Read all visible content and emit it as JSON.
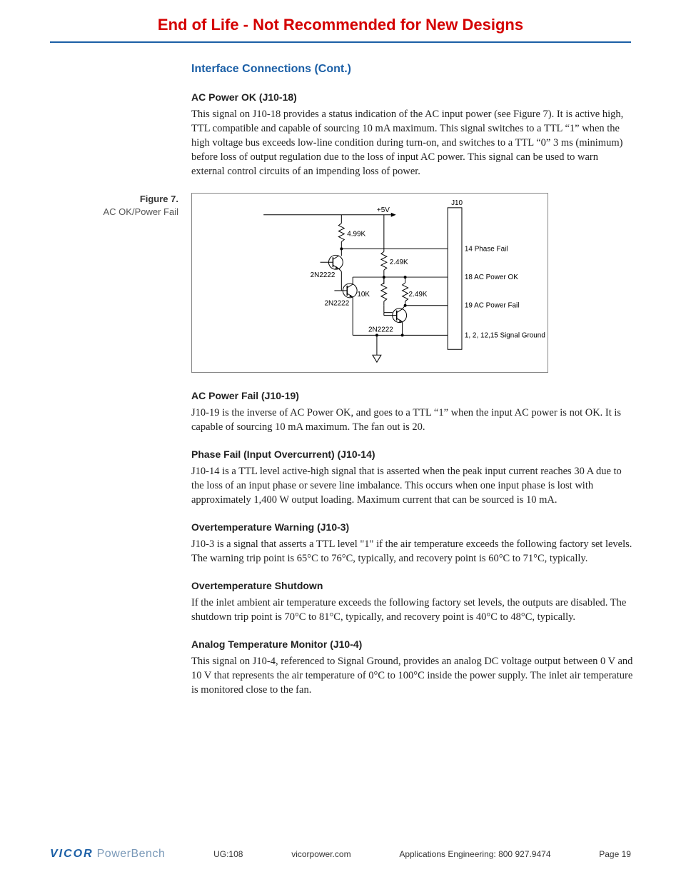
{
  "banner": "End of Life - Not Recommended for New Designs",
  "sectionTitle": "Interface Connections (Cont.)",
  "sections": [
    {
      "heading": "AC Power OK (J10-18)",
      "body": "This signal on J10-18 provides a status indication of the AC input power (see Figure 7). It is active high, TTL compatible and capable of sourcing 10 mA maximum. This signal switches to a TTL “1” when the high voltage bus exceeds low-line condition during turn-on, and switches to a TTL “0” 3 ms (minimum) before loss of output regulation due to the loss of input AC power. This signal can be used to warn external control circuits of an impending loss of power."
    },
    {
      "heading": "AC Power Fail (J10-19)",
      "body": "J10-19 is the inverse of AC Power OK, and goes to a TTL “1” when the input AC power is not OK. It is capable of sourcing 10 mA maximum. The fan out is 20."
    },
    {
      "heading": "Phase Fail (Input Overcurrent) (J10-14)",
      "body": "J10-14 is a TTL level active-high signal that is asserted when the peak input current reaches 30 A due to the loss of an input phase or severe line imbalance. This occurs when one input phase is lost with approximately 1,400 W output loading. Maximum current that can be sourced is 10 mA."
    },
    {
      "heading": "Overtemperature Warning (J10-3)",
      "body": "J10-3 is a signal that asserts a TTL level \"1\" if the air temperature exceeds the following factory set levels. The warning trip point is 65°C to 76°C, typically, and recovery point is 60°C to 71°C, typically."
    },
    {
      "heading": "Overtemperature Shutdown",
      "body": "If the inlet ambient air temperature exceeds the following factory set levels, the outputs are disabled. The shutdown trip point is 70°C to 81°C, typically, and recovery point is 40°C to 48°C, typically."
    },
    {
      "heading": "Analog Temperature Monitor (J10-4)",
      "body": "This signal on J10-4, referenced to Signal Ground, provides an analog DC voltage output between 0 V and 10 V that represents the air temperature of 0°C to 100°C inside the power supply. The inlet air temperature is monitored close to the fan."
    }
  ],
  "figure": {
    "labelNum": "Figure 7.",
    "labelCaption": "AC OK/Power Fail",
    "labels": {
      "v5": "+5V",
      "j10": "J10",
      "r1": "4.99K",
      "r2": "2.49K",
      "r3": "10K",
      "r4": "2.49K",
      "q": "2N2222",
      "pin14": "14 Phase Fail",
      "pin18": "18 AC Power OK",
      "pin19": "19 AC Power Fail",
      "gnd": "1, 2, 12,15 Signal Ground"
    }
  },
  "footer": {
    "logo1": "VICOR",
    "logo2": " PowerBench",
    "ug": "UG:108",
    "url": "vicorpower.com",
    "contact": "Applications Engineering: 800 927.9474",
    "page": "Page 19"
  }
}
